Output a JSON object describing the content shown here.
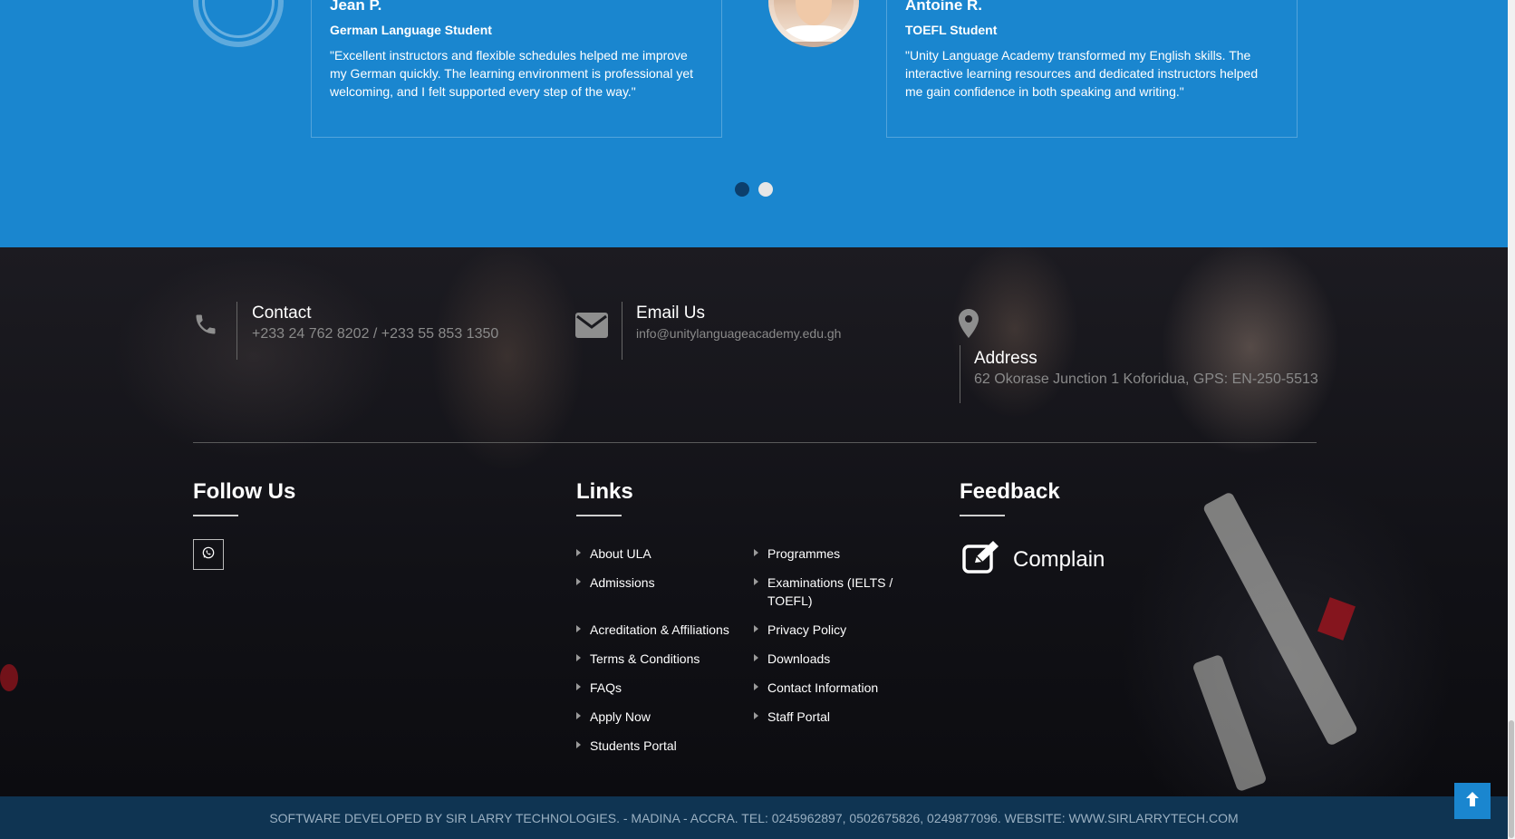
{
  "testimonials": {
    "items": [
      {
        "name": "Jean P.",
        "role": "German Language Student",
        "quote": "\"Excellent instructors and flexible schedules helped me improve my German quickly. The learning environment is professional yet welcoming, and I felt supported every step of the way.\""
      },
      {
        "name": "Antoine R.",
        "role": "TOEFL Student",
        "quote": "\"Unity Language Academy transformed my English skills. The interactive learning resources and dedicated instructors helped me gain confidence in both speaking and writing.\""
      }
    ],
    "pages": 2,
    "active_page": 1
  },
  "contact": {
    "phone": {
      "title": "Contact",
      "value": "+233 24 762 8202 / +233 55 853 1350",
      "icon": "phone-icon"
    },
    "email": {
      "title": "Email Us",
      "value": "info@unitylanguageacademy.edu.gh",
      "icon": "envelope-icon"
    },
    "address": {
      "title": "Address",
      "value": "62 Okorase Junction 1 Koforidua, GPS: EN-250-5513",
      "icon": "map-marker-icon"
    }
  },
  "follow": {
    "title": "Follow Us",
    "social": [
      {
        "icon": "whatsapp-icon"
      }
    ]
  },
  "links": {
    "title": "Links",
    "left": [
      "About ULA",
      "Admissions",
      "Acreditation & Affiliations",
      "Terms & Conditions",
      "FAQs",
      "Apply Now",
      "Students Portal"
    ],
    "right": [
      "Programmes",
      "Examinations (IELTS / TOEFL)",
      "Privacy Policy",
      "Downloads",
      "Contact Information",
      "Staff Portal"
    ]
  },
  "feedback": {
    "title": "Feedback",
    "complain_label": "Complain",
    "complain_icon": "edit-icon"
  },
  "bottom_bar": {
    "text": "SOFTWARE DEVELOPED BY SIR LARRY TECHNOLOGIES. - MADINA - ACCRA. TEL: 0245962897, 0502675826, 0249877096. WEBSITE: WWW.SIRLARRYTECH.COM"
  },
  "colors": {
    "primary_blue": "#1a86cf",
    "bottom_bar": "#0f3452",
    "active_dot": "#0c3f6d"
  }
}
